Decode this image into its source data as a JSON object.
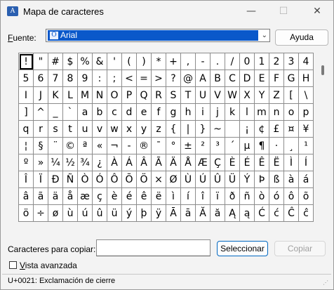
{
  "window": {
    "title": "Mapa de caracteres",
    "app_icon_glyph": "A",
    "minimize_glyph": "—",
    "maximize_glyph": "☐",
    "close_glyph": "✕"
  },
  "font": {
    "label_prefix": "F",
    "label_rest": "uente:",
    "selected": "Arial",
    "icon_glyph": "O",
    "chevron_glyph": "⌄"
  },
  "help_button": {
    "label": "Ayuda"
  },
  "characters": [
    "!",
    "\"",
    "#",
    "$",
    "%",
    "&",
    "'",
    "(",
    ")",
    "*",
    "+",
    ",",
    "-",
    ".",
    "/",
    "0",
    "1",
    "2",
    "3",
    "4",
    "5",
    "6",
    "7",
    "8",
    "9",
    ":",
    ";",
    "<",
    "=",
    ">",
    "?",
    "@",
    "A",
    "B",
    "C",
    "D",
    "E",
    "F",
    "G",
    "H",
    "I",
    "J",
    "K",
    "L",
    "M",
    "N",
    "O",
    "P",
    "Q",
    "R",
    "S",
    "T",
    "U",
    "V",
    "W",
    "X",
    "Y",
    "Z",
    "[",
    "\\",
    "]",
    "^",
    "_",
    "`",
    "a",
    "b",
    "c",
    "d",
    "e",
    "f",
    "g",
    "h",
    "i",
    "j",
    "k",
    "l",
    "m",
    "n",
    "o",
    "p",
    "q",
    "r",
    "s",
    "t",
    "u",
    "v",
    "w",
    "x",
    "y",
    "z",
    "{",
    "|",
    "}",
    "~",
    " ",
    "¡",
    "¢",
    "£",
    "¤",
    "¥",
    "¦",
    "§",
    "¨",
    "©",
    "ª",
    "«",
    "¬",
    "-",
    "®",
    "¯",
    "°",
    "±",
    "²",
    "³",
    "´",
    "µ",
    "¶",
    "·",
    "¸",
    "¹",
    "º",
    "»",
    "¼",
    "½",
    "¾",
    "¿",
    "À",
    "Á",
    "Â",
    "Ã",
    "Ä",
    "Å",
    "Æ",
    "Ç",
    "È",
    "É",
    "Ê",
    "Ë",
    "Ì",
    "Í",
    "Î",
    "Ï",
    "Ð",
    "Ñ",
    "Ò",
    "Ó",
    "Ô",
    "Õ",
    "Ö",
    "×",
    "Ø",
    "Ù",
    "Ú",
    "Û",
    "Ü",
    "Ý",
    "Þ",
    "ß",
    "à",
    "á",
    "â",
    "ã",
    "ä",
    "å",
    "æ",
    "ç",
    "è",
    "é",
    "ê",
    "ë",
    "ì",
    "í",
    "î",
    "ï",
    "ð",
    "ñ",
    "ò",
    "ó",
    "ô",
    "õ",
    "ö",
    "÷",
    "ø",
    "ù",
    "ú",
    "û",
    "ü",
    "ý",
    "þ",
    "ÿ",
    "Ā",
    "ā",
    "Ă",
    "ă",
    "Ą",
    "ą",
    "Ć",
    "ć",
    "Ĉ",
    "ĉ"
  ],
  "selected_index": 0,
  "copy": {
    "label": "Caracteres para copiar:",
    "value": "",
    "select_button": "Seleccionar",
    "copy_button": "Copiar"
  },
  "advanced": {
    "prefix": "V",
    "rest": "ista avanzada",
    "checked": false
  },
  "status": {
    "text": "U+0021: Exclamación de cierre"
  },
  "icons": {
    "app": "character-map-icon",
    "font": "opentype-font-icon",
    "resize": "size-grip-icon"
  }
}
